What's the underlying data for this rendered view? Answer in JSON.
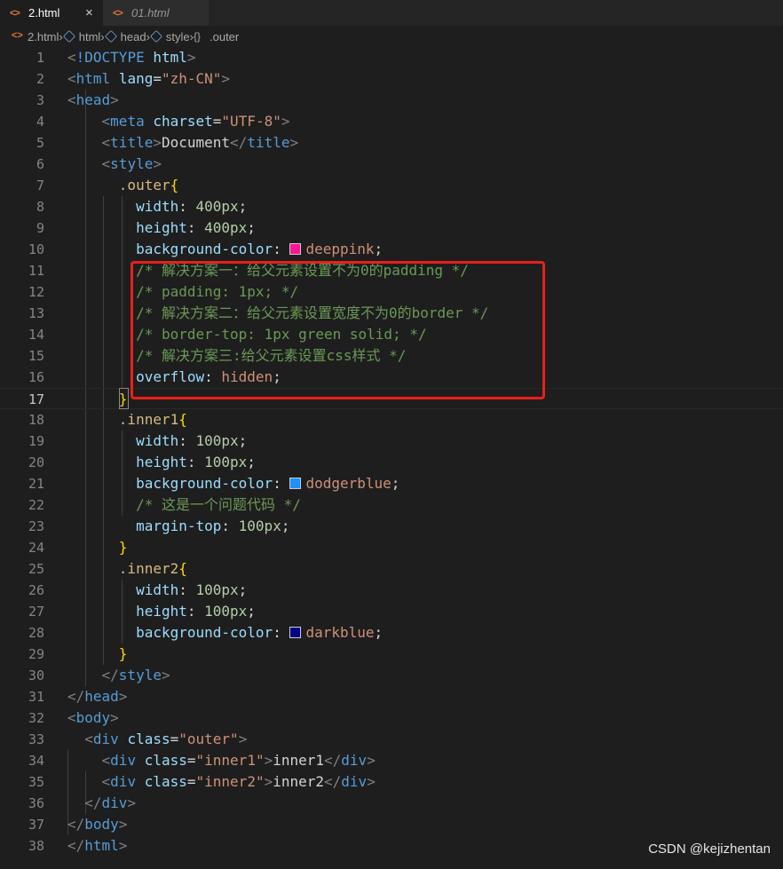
{
  "tabs": [
    {
      "label": "2.html",
      "icon": "html-file-icon",
      "active": true
    },
    {
      "label": "01.html",
      "icon": "html-file-icon",
      "active": false
    }
  ],
  "tab_close_glyph": "×",
  "file_icon_glyph": "<>",
  "breadcrumb": [
    {
      "label": "2.html",
      "icon": "html-file-icon"
    },
    {
      "label": "html",
      "icon": "element-icon"
    },
    {
      "label": "head",
      "icon": "element-icon"
    },
    {
      "label": "style",
      "icon": "element-icon"
    },
    {
      "label": ".outer",
      "icon": "css-rule-icon"
    }
  ],
  "current_line": 17,
  "colors": {
    "deeppink": "#ff1493",
    "dodgerblue": "#1e90ff",
    "darkblue": "#00008b",
    "highlight_box": "#e8201a"
  },
  "code_lines": [
    [
      [
        "bracket",
        "<"
      ],
      [
        "tag",
        "!DOCTYPE "
      ],
      [
        "attr",
        "html"
      ],
      [
        "bracket",
        ">"
      ]
    ],
    [
      [
        "bracket",
        "<"
      ],
      [
        "tag",
        "html "
      ],
      [
        "attr",
        "lang"
      ],
      [
        "punc",
        "="
      ],
      [
        "str",
        "\"zh-CN\""
      ],
      [
        "bracket",
        ">"
      ]
    ],
    [
      [
        "bracket",
        "<"
      ],
      [
        "tag",
        "head"
      ],
      [
        "bracket",
        ">"
      ]
    ],
    [
      [
        "pad",
        "    "
      ],
      [
        "bracket",
        "<"
      ],
      [
        "tag",
        "meta "
      ],
      [
        "attr",
        "charset"
      ],
      [
        "punc",
        "="
      ],
      [
        "str",
        "\"UTF-8\""
      ],
      [
        "bracket",
        ">"
      ]
    ],
    [
      [
        "pad",
        "    "
      ],
      [
        "bracket",
        "<"
      ],
      [
        "tag",
        "title"
      ],
      [
        "bracket",
        ">"
      ],
      [
        "text",
        "Document"
      ],
      [
        "bracket",
        "</"
      ],
      [
        "tag",
        "title"
      ],
      [
        "bracket",
        ">"
      ]
    ],
    [
      [
        "pad",
        "    "
      ],
      [
        "bracket",
        "<"
      ],
      [
        "tag",
        "style"
      ],
      [
        "bracket",
        ">"
      ]
    ],
    [
      [
        "pad",
        "      "
      ],
      [
        "sel",
        ".outer"
      ],
      [
        "brace",
        "{"
      ]
    ],
    [
      [
        "pad",
        "        "
      ],
      [
        "prop",
        "width"
      ],
      [
        "punc",
        ": "
      ],
      [
        "num",
        "400px"
      ],
      [
        "punc",
        ";"
      ]
    ],
    [
      [
        "pad",
        "        "
      ],
      [
        "prop",
        "height"
      ],
      [
        "punc",
        ": "
      ],
      [
        "num",
        "400px"
      ],
      [
        "punc",
        ";"
      ]
    ],
    [
      [
        "pad",
        "        "
      ],
      [
        "prop",
        "background-color"
      ],
      [
        "punc",
        ": "
      ],
      [
        "swatch",
        "deeppink"
      ],
      [
        "val",
        "deeppink"
      ],
      [
        "punc",
        ";"
      ]
    ],
    [
      [
        "pad",
        "        "
      ],
      [
        "com",
        "/* 解决方案一：给父元素设置不为0的padding */"
      ]
    ],
    [
      [
        "pad",
        "        "
      ],
      [
        "com",
        "/* padding: 1px; */"
      ]
    ],
    [
      [
        "pad",
        "        "
      ],
      [
        "com",
        "/* 解决方案二：给父元素设置宽度不为0的border */"
      ]
    ],
    [
      [
        "pad",
        "        "
      ],
      [
        "com",
        "/* border-top: 1px green solid; */"
      ]
    ],
    [
      [
        "pad",
        "        "
      ],
      [
        "com",
        "/* 解决方案三:给父元素设置css样式 */"
      ]
    ],
    [
      [
        "pad",
        "        "
      ],
      [
        "prop",
        "overflow"
      ],
      [
        "punc",
        ": "
      ],
      [
        "val",
        "hidden"
      ],
      [
        "punc",
        ";"
      ]
    ],
    [
      [
        "pad",
        "      "
      ],
      [
        "brace",
        "}"
      ]
    ],
    [
      [
        "pad",
        "      "
      ],
      [
        "sel",
        ".inner1"
      ],
      [
        "brace",
        "{"
      ]
    ],
    [
      [
        "pad",
        "        "
      ],
      [
        "prop",
        "width"
      ],
      [
        "punc",
        ": "
      ],
      [
        "num",
        "100px"
      ],
      [
        "punc",
        ";"
      ]
    ],
    [
      [
        "pad",
        "        "
      ],
      [
        "prop",
        "height"
      ],
      [
        "punc",
        ": "
      ],
      [
        "num",
        "100px"
      ],
      [
        "punc",
        ";"
      ]
    ],
    [
      [
        "pad",
        "        "
      ],
      [
        "prop",
        "background-color"
      ],
      [
        "punc",
        ": "
      ],
      [
        "swatch",
        "dodgerblue"
      ],
      [
        "val",
        "dodgerblue"
      ],
      [
        "punc",
        ";"
      ]
    ],
    [
      [
        "pad",
        "        "
      ],
      [
        "com",
        "/* 这是一个问题代码 */"
      ]
    ],
    [
      [
        "pad",
        "        "
      ],
      [
        "prop",
        "margin-top"
      ],
      [
        "punc",
        ": "
      ],
      [
        "num",
        "100px"
      ],
      [
        "punc",
        ";"
      ]
    ],
    [
      [
        "pad",
        "      "
      ],
      [
        "brace",
        "}"
      ]
    ],
    [
      [
        "pad",
        "      "
      ],
      [
        "sel",
        ".inner2"
      ],
      [
        "brace",
        "{"
      ]
    ],
    [
      [
        "pad",
        "        "
      ],
      [
        "prop",
        "width"
      ],
      [
        "punc",
        ": "
      ],
      [
        "num",
        "100px"
      ],
      [
        "punc",
        ";"
      ]
    ],
    [
      [
        "pad",
        "        "
      ],
      [
        "prop",
        "height"
      ],
      [
        "punc",
        ": "
      ],
      [
        "num",
        "100px"
      ],
      [
        "punc",
        ";"
      ]
    ],
    [
      [
        "pad",
        "        "
      ],
      [
        "prop",
        "background-color"
      ],
      [
        "punc",
        ": "
      ],
      [
        "swatch",
        "darkblue"
      ],
      [
        "val",
        "darkblue"
      ],
      [
        "punc",
        ";"
      ]
    ],
    [
      [
        "pad",
        "      "
      ],
      [
        "brace",
        "}"
      ]
    ],
    [
      [
        "pad",
        "    "
      ],
      [
        "bracket",
        "</"
      ],
      [
        "tag",
        "style"
      ],
      [
        "bracket",
        ">"
      ]
    ],
    [
      [
        "bracket",
        "</"
      ],
      [
        "tag",
        "head"
      ],
      [
        "bracket",
        ">"
      ]
    ],
    [
      [
        "bracket",
        "<"
      ],
      [
        "tag",
        "body"
      ],
      [
        "bracket",
        ">"
      ]
    ],
    [
      [
        "pad",
        "  "
      ],
      [
        "bracket",
        "<"
      ],
      [
        "tag",
        "div "
      ],
      [
        "attr",
        "class"
      ],
      [
        "punc",
        "="
      ],
      [
        "str",
        "\"outer\""
      ],
      [
        "bracket",
        ">"
      ]
    ],
    [
      [
        "pad",
        "    "
      ],
      [
        "bracket",
        "<"
      ],
      [
        "tag",
        "div "
      ],
      [
        "attr",
        "class"
      ],
      [
        "punc",
        "="
      ],
      [
        "str",
        "\"inner1\""
      ],
      [
        "bracket",
        ">"
      ],
      [
        "text",
        "inner1"
      ],
      [
        "bracket",
        "</"
      ],
      [
        "tag",
        "div"
      ],
      [
        "bracket",
        ">"
      ]
    ],
    [
      [
        "pad",
        "    "
      ],
      [
        "bracket",
        "<"
      ],
      [
        "tag",
        "div "
      ],
      [
        "attr",
        "class"
      ],
      [
        "punc",
        "="
      ],
      [
        "str",
        "\"inner2\""
      ],
      [
        "bracket",
        ">"
      ],
      [
        "text",
        "inner2"
      ],
      [
        "bracket",
        "</"
      ],
      [
        "tag",
        "div"
      ],
      [
        "bracket",
        ">"
      ]
    ],
    [
      [
        "pad",
        "  "
      ],
      [
        "bracket",
        "</"
      ],
      [
        "tag",
        "div"
      ],
      [
        "bracket",
        ">"
      ]
    ],
    [
      [
        "bracket",
        "</"
      ],
      [
        "tag",
        "body"
      ],
      [
        "bracket",
        ">"
      ]
    ],
    [
      [
        "bracket",
        "</"
      ],
      [
        "tag",
        "html"
      ],
      [
        "bracket",
        ">"
      ]
    ]
  ],
  "watermark": "CSDN @kejizhentan"
}
